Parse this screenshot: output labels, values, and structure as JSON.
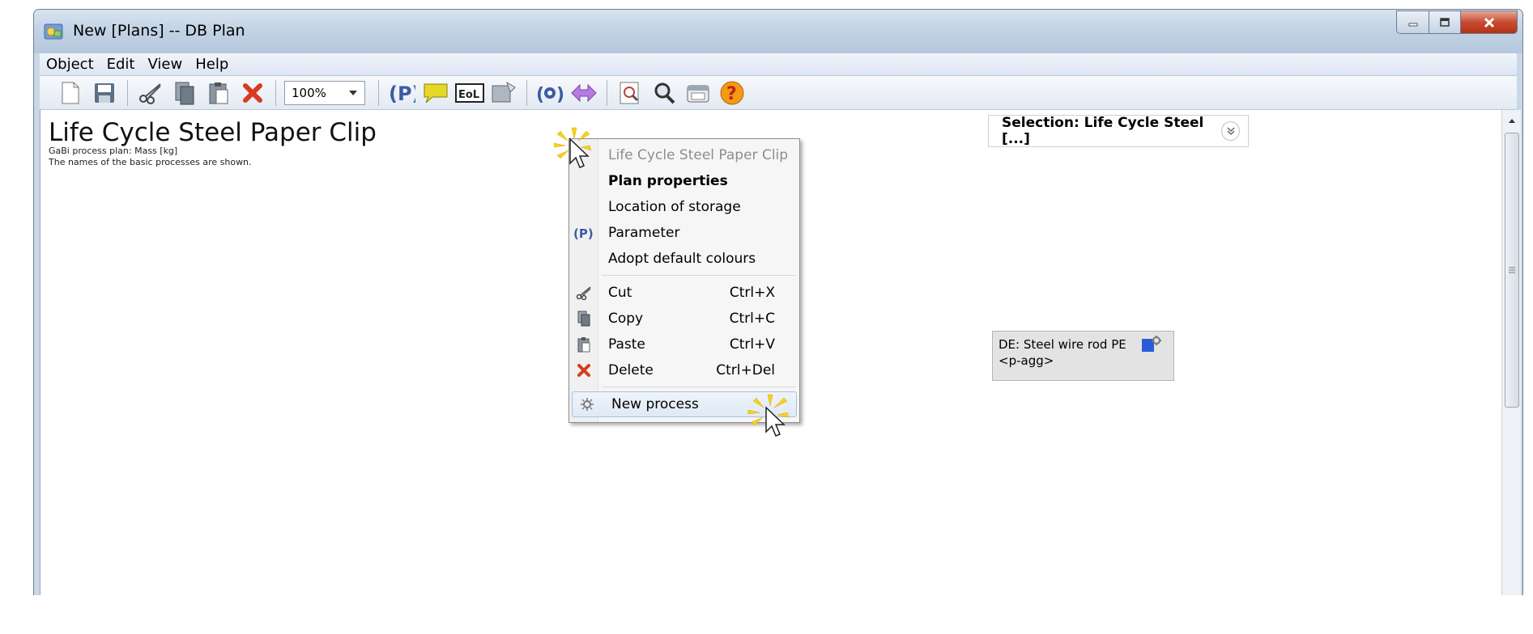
{
  "window": {
    "title": "New [Plans] -- DB Plan"
  },
  "menubar": {
    "items": [
      "Object",
      "Edit",
      "View",
      "Help"
    ]
  },
  "toolbar": {
    "zoom_value": "100%"
  },
  "plan": {
    "title": "Life Cycle Steel Paper Clip",
    "subtitle_line1": "GaBi process plan: Mass [kg]",
    "subtitle_line2": "The names of the basic processes are shown."
  },
  "selection": {
    "label": "Selection: Life Cycle Steel  [...]"
  },
  "process": {
    "line1": "DE: Steel wire rod PE",
    "line2": "<p-agg>"
  },
  "context_menu": {
    "header": "Life Cycle Steel Paper Clip",
    "plan_properties": "Plan properties",
    "location_of_storage": "Location of storage",
    "parameter": "Parameter",
    "adopt_default_colours": "Adopt default colours",
    "cut": "Cut",
    "cut_shortcut": "Ctrl+X",
    "copy": "Copy",
    "copy_shortcut": "Ctrl+C",
    "paste": "Paste",
    "paste_shortcut": "Ctrl+V",
    "delete": "Delete",
    "delete_shortcut": "Ctrl+Del",
    "new_process": "New process"
  },
  "colors": {
    "accent": "#3b5ba5",
    "delete_red": "#d83a1f",
    "help_orange": "#f29b12"
  }
}
